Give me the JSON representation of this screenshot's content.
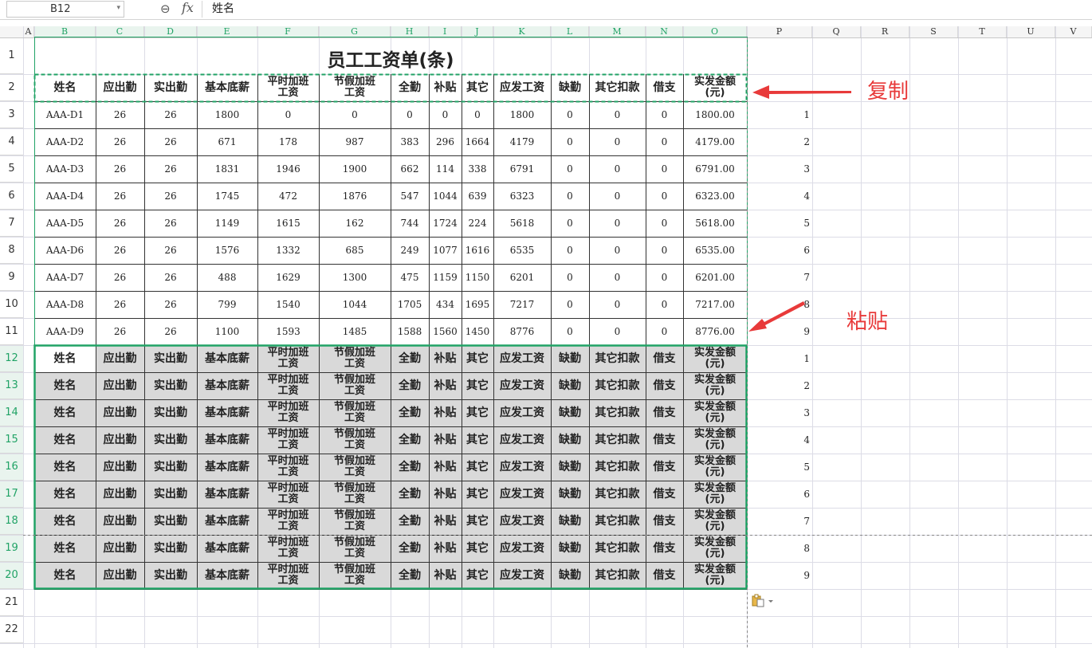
{
  "formula_bar": {
    "cell_ref": "B12",
    "zoom_icon": "zoom-icon",
    "fx_label": "fx",
    "content": "姓名"
  },
  "columns": [
    "A",
    "B",
    "C",
    "D",
    "E",
    "F",
    "G",
    "H",
    "I",
    "J",
    "K",
    "L",
    "M",
    "N",
    "O",
    "P",
    "Q",
    "R",
    "S",
    "T",
    "U",
    "V"
  ],
  "rows": [
    "1",
    "2",
    "3",
    "4",
    "5",
    "6",
    "7",
    "8",
    "9",
    "10",
    "11",
    "12",
    "13",
    "14",
    "15",
    "16",
    "17",
    "18",
    "19",
    "20",
    "21",
    "22"
  ],
  "sheet": {
    "title": "员工工资单(条)",
    "header": [
      "姓名",
      "应出勤",
      "实出勤",
      "基本底薪",
      "平时加班\n工资",
      "节假加班\n工资",
      "全勤",
      "补贴",
      "其它",
      "应发工资",
      "缺勤",
      "其它扣款",
      "借支",
      "实发金额\n(元)"
    ],
    "data_rows": [
      [
        "AAA-D1",
        "26",
        "26",
        "1800",
        "0",
        "0",
        "0",
        "0",
        "0",
        "1800",
        "0",
        "0",
        "0",
        "1800.00"
      ],
      [
        "AAA-D2",
        "26",
        "26",
        "671",
        "178",
        "987",
        "383",
        "296",
        "1664",
        "4179",
        "0",
        "0",
        "0",
        "4179.00"
      ],
      [
        "AAA-D3",
        "26",
        "26",
        "1831",
        "1946",
        "1900",
        "662",
        "114",
        "338",
        "6791",
        "0",
        "0",
        "0",
        "6791.00"
      ],
      [
        "AAA-D4",
        "26",
        "26",
        "1745",
        "472",
        "1876",
        "547",
        "1044",
        "639",
        "6323",
        "0",
        "0",
        "0",
        "6323.00"
      ],
      [
        "AAA-D5",
        "26",
        "26",
        "1149",
        "1615",
        "162",
        "744",
        "1724",
        "224",
        "5618",
        "0",
        "0",
        "0",
        "5618.00"
      ],
      [
        "AAA-D6",
        "26",
        "26",
        "1576",
        "1332",
        "685",
        "249",
        "1077",
        "1616",
        "6535",
        "0",
        "0",
        "0",
        "6535.00"
      ],
      [
        "AAA-D7",
        "26",
        "26",
        "488",
        "1629",
        "1300",
        "475",
        "1159",
        "1150",
        "6201",
        "0",
        "0",
        "0",
        "6201.00"
      ],
      [
        "AAA-D8",
        "26",
        "26",
        "799",
        "1540",
        "1044",
        "1705",
        "434",
        "1695",
        "7217",
        "0",
        "0",
        "0",
        "7217.00"
      ],
      [
        "AAA-D9",
        "26",
        "26",
        "1100",
        "1593",
        "1485",
        "1588",
        "1560",
        "1450",
        "8776",
        "0",
        "0",
        "0",
        "8776.00"
      ]
    ],
    "helper_upper": [
      "1",
      "2",
      "3",
      "4",
      "5",
      "6",
      "7",
      "8",
      "9"
    ],
    "helper_lower": [
      "1",
      "2",
      "3",
      "4",
      "5",
      "6",
      "7",
      "8",
      "9"
    ]
  },
  "annotations": {
    "copy": "复制",
    "paste": "粘贴"
  },
  "colors": {
    "accent": "#21a366",
    "arrow": "#e83a3a",
    "paste_fill": "#d9d9d9"
  },
  "paste_options_icon": "clipboard-icon"
}
